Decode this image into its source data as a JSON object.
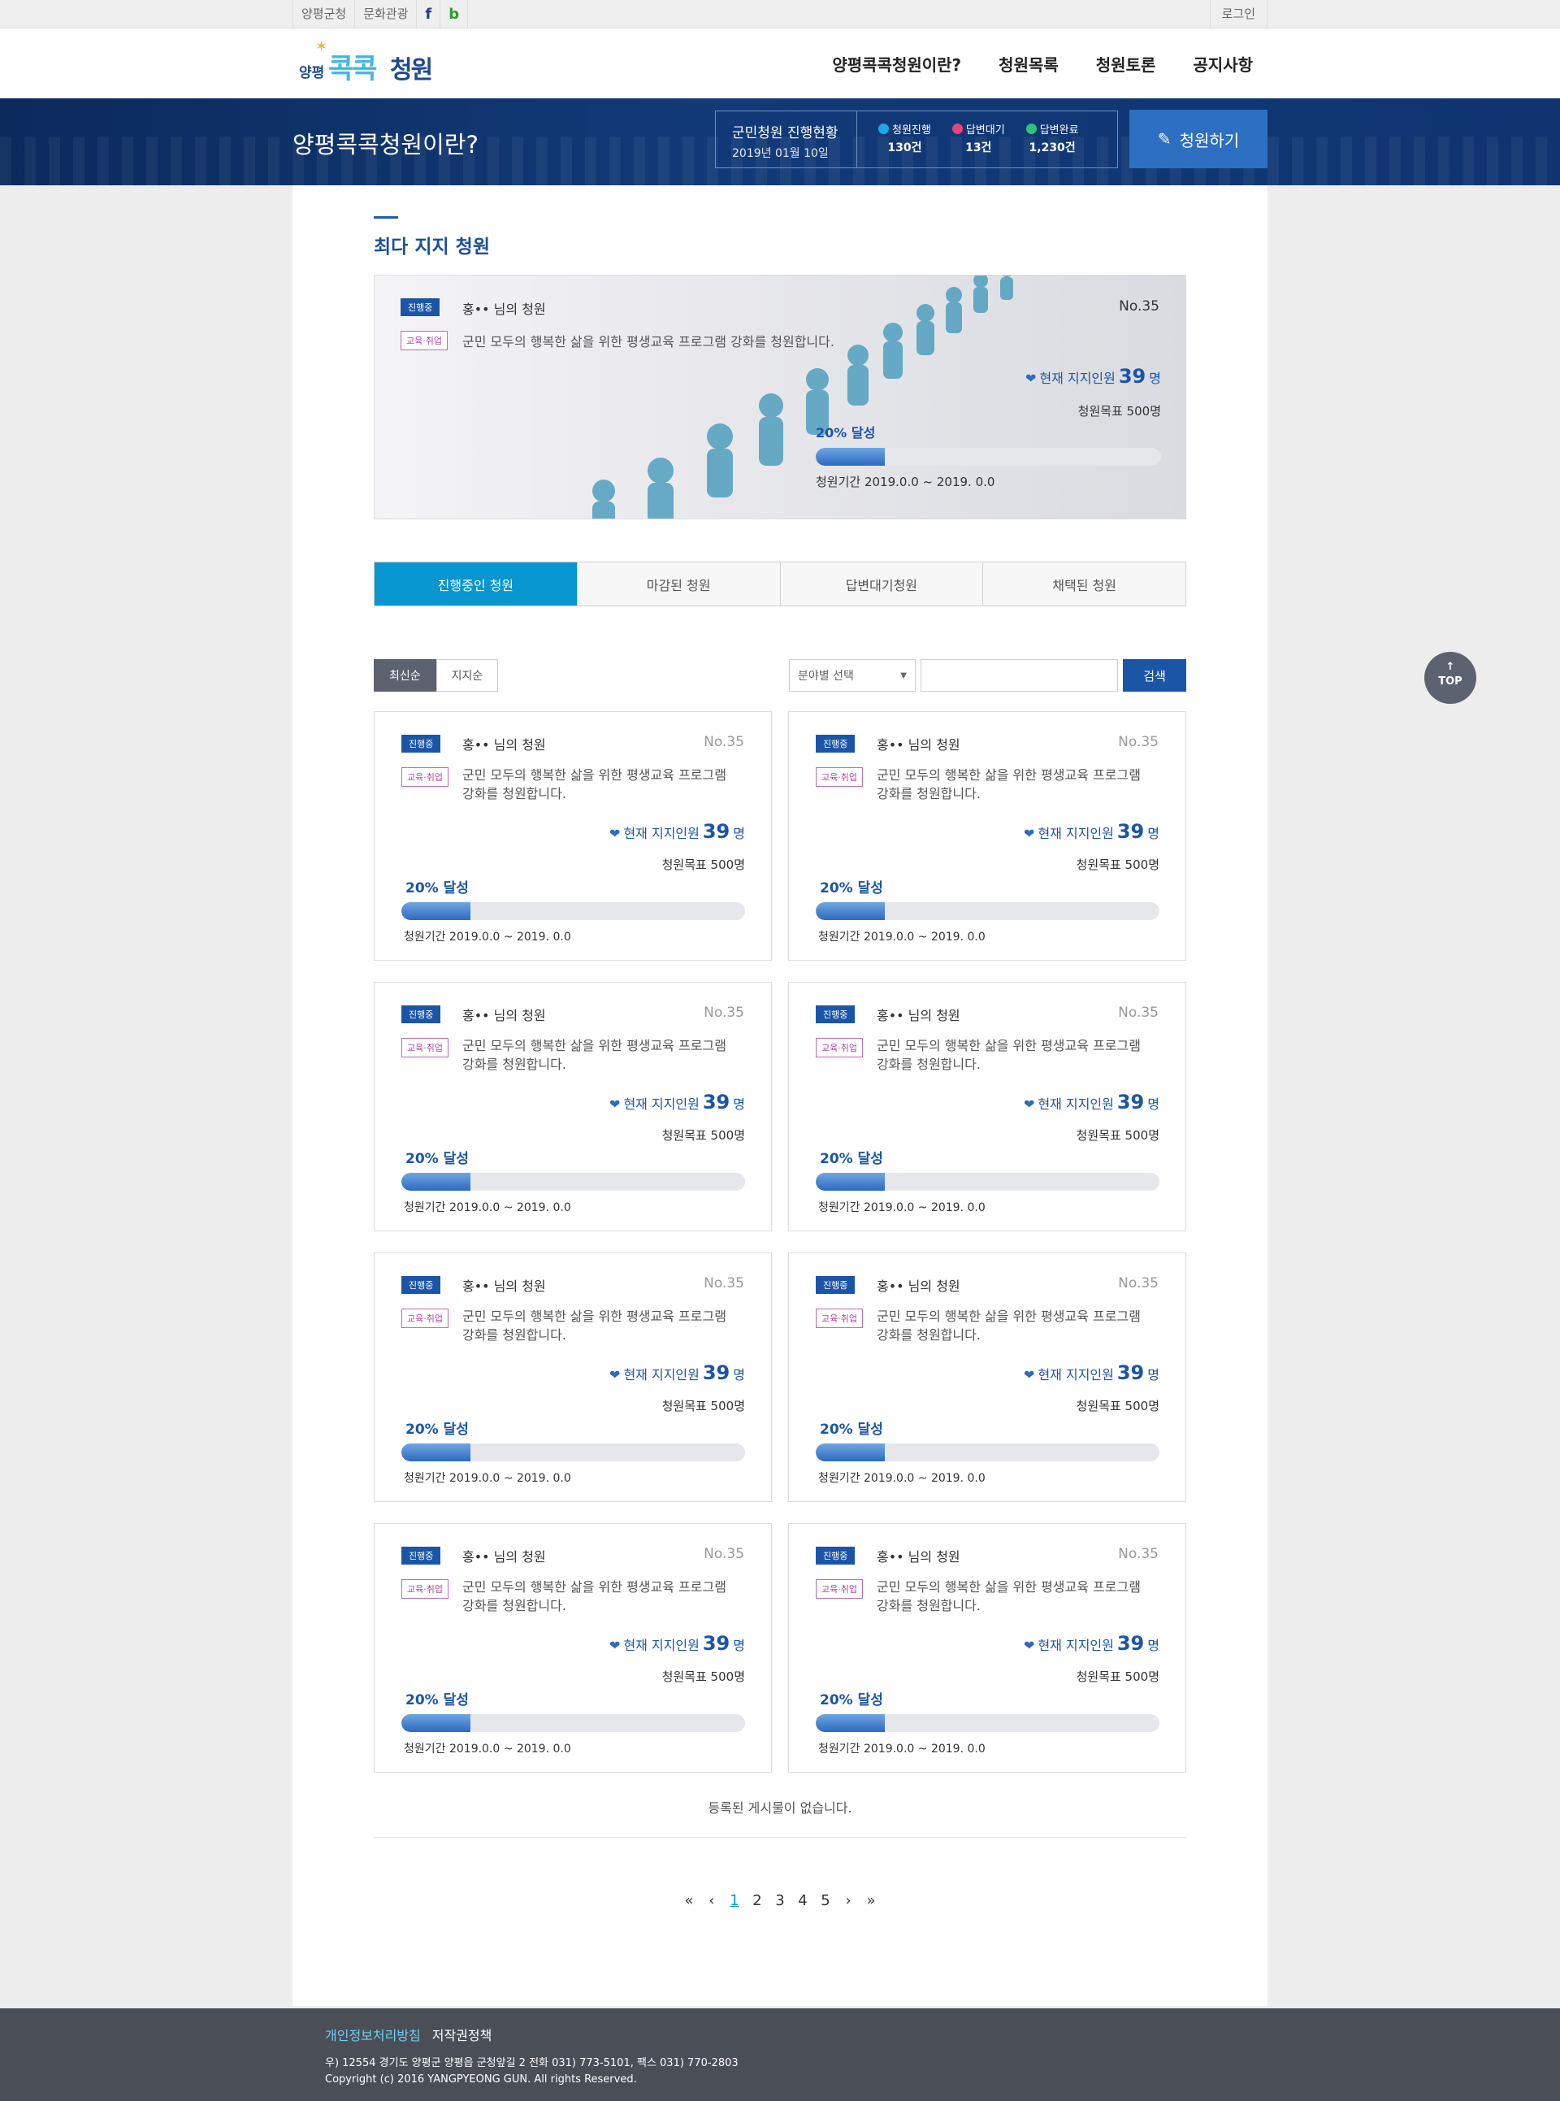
{
  "util": {
    "links": [
      "양평군청",
      "문화관광"
    ],
    "facebook": "f",
    "blog": "b",
    "login": "로그인"
  },
  "logo": {
    "small": "양평",
    "big1": "콕콕",
    "big2": "청원"
  },
  "gnb": [
    "양평콕콕청원이란?",
    "청원목록",
    "청원토론",
    "공지사항"
  ],
  "band": {
    "title": "양평콕콕청원이란?",
    "status_title": "군민청원 진행현황",
    "status_date": "2019년 01월 10일",
    "status_items": [
      {
        "label": "청원진행",
        "value": "130건",
        "color": "#1ea7e8"
      },
      {
        "label": "답변대기",
        "value": "13건",
        "color": "#e8457a"
      },
      {
        "label": "답변완료",
        "value": "1,230건",
        "color": "#2fc27a"
      }
    ],
    "write_button": "청원하기"
  },
  "featured": {
    "section_title": "최다 지지 청원",
    "status": "진행중",
    "author": "홍•• 님의 청원",
    "no": "No.35",
    "category": "교육·취업",
    "desc": "군민 모두의 행복한 삶을 위한 평생교육 프로그램 강화를 청원합니다.",
    "support_label": "현재 지지인원",
    "support_count": "39",
    "support_unit": "명",
    "goal": "청원목표 500명",
    "pct_label": "20% 달성",
    "progress": 0.2,
    "period": "청원기간 2019.0.0 ~ 2019. 0.0"
  },
  "tabs": [
    "진행중인 청원",
    "마감된 청원",
    "답변대기청원",
    "채택된 청원"
  ],
  "sort": [
    "최신순",
    "지지순"
  ],
  "search": {
    "select_label": "분야별 선택",
    "button": "검색"
  },
  "cards": [
    {
      "status": "진행중",
      "author": "홍•• 님의 청원",
      "no": "No.35",
      "category": "교육·취업",
      "desc": "군민 모두의 행복한 삶을 위한 평생교육 프로그램 강화를 청원합니다.",
      "support_label": "현재 지지인원",
      "support_count": "39",
      "support_unit": "명",
      "goal": "청원목표 500명",
      "pct_label": "20% 달성",
      "progress": 0.2,
      "period": "청원기간 2019.0.0 ~ 2019. 0.0"
    },
    {
      "status": "진행중",
      "author": "홍•• 님의 청원",
      "no": "No.35",
      "category": "교육·취업",
      "desc": "군민 모두의 행복한 삶을 위한 평생교육 프로그램 강화를 청원합니다.",
      "support_label": "현재 지지인원",
      "support_count": "39",
      "support_unit": "명",
      "goal": "청원목표 500명",
      "pct_label": "20% 달성",
      "progress": 0.2,
      "period": "청원기간 2019.0.0 ~ 2019. 0.0"
    },
    {
      "status": "진행중",
      "author": "홍•• 님의 청원",
      "no": "No.35",
      "category": "교육·취업",
      "desc": "군민 모두의 행복한 삶을 위한 평생교육 프로그램 강화를 청원합니다.",
      "support_label": "현재 지지인원",
      "support_count": "39",
      "support_unit": "명",
      "goal": "청원목표 500명",
      "pct_label": "20% 달성",
      "progress": 0.2,
      "period": "청원기간 2019.0.0 ~ 2019. 0.0"
    },
    {
      "status": "진행중",
      "author": "홍•• 님의 청원",
      "no": "No.35",
      "category": "교육·취업",
      "desc": "군민 모두의 행복한 삶을 위한 평생교육 프로그램 강화를 청원합니다.",
      "support_label": "현재 지지인원",
      "support_count": "39",
      "support_unit": "명",
      "goal": "청원목표 500명",
      "pct_label": "20% 달성",
      "progress": 0.2,
      "period": "청원기간 2019.0.0 ~ 2019. 0.0"
    },
    {
      "status": "진행중",
      "author": "홍•• 님의 청원",
      "no": "No.35",
      "category": "교육·취업",
      "desc": "군민 모두의 행복한 삶을 위한 평생교육 프로그램 강화를 청원합니다.",
      "support_label": "현재 지지인원",
      "support_count": "39",
      "support_unit": "명",
      "goal": "청원목표 500명",
      "pct_label": "20% 달성",
      "progress": 0.2,
      "period": "청원기간 2019.0.0 ~ 2019. 0.0"
    },
    {
      "status": "진행중",
      "author": "홍•• 님의 청원",
      "no": "No.35",
      "category": "교육·취업",
      "desc": "군민 모두의 행복한 삶을 위한 평생교육 프로그램 강화를 청원합니다.",
      "support_label": "현재 지지인원",
      "support_count": "39",
      "support_unit": "명",
      "goal": "청원목표 500명",
      "pct_label": "20% 달성",
      "progress": 0.2,
      "period": "청원기간 2019.0.0 ~ 2019. 0.0"
    },
    {
      "status": "진행중",
      "author": "홍•• 님의 청원",
      "no": "No.35",
      "category": "교육·취업",
      "desc": "군민 모두의 행복한 삶을 위한 평생교육 프로그램 강화를 청원합니다.",
      "support_label": "현재 지지인원",
      "support_count": "39",
      "support_unit": "명",
      "goal": "청원목표 500명",
      "pct_label": "20% 달성",
      "progress": 0.2,
      "period": "청원기간 2019.0.0 ~ 2019. 0.0"
    },
    {
      "status": "진행중",
      "author": "홍•• 님의 청원",
      "no": "No.35",
      "category": "교육·취업",
      "desc": "군민 모두의 행복한 삶을 위한 평생교육 프로그램 강화를 청원합니다.",
      "support_label": "현재 지지인원",
      "support_count": "39",
      "support_unit": "명",
      "goal": "청원목표 500명",
      "pct_label": "20% 달성",
      "progress": 0.2,
      "period": "청원기간 2019.0.0 ~ 2019. 0.0"
    }
  ],
  "empty_message": "등록된 게시물이 없습니다.",
  "pagination": {
    "first": "«",
    "prev": "‹",
    "pages": [
      "1",
      "2",
      "3",
      "4",
      "5"
    ],
    "current": "1",
    "next": "›",
    "last": "»"
  },
  "top_button": {
    "arrow": "↑",
    "label": "TOP"
  },
  "footer": {
    "privacy": "개인정보처리방침",
    "copyright_policy": "저작권정책",
    "address": "우) 12554 경기도 양평군 양평읍 군청앞길 2  전화 031) 773-5101, 팩스 031) 770-2803",
    "copyright": "Copyright (c) 2016 YANGPYEONG GUN. All rights Reserved."
  }
}
